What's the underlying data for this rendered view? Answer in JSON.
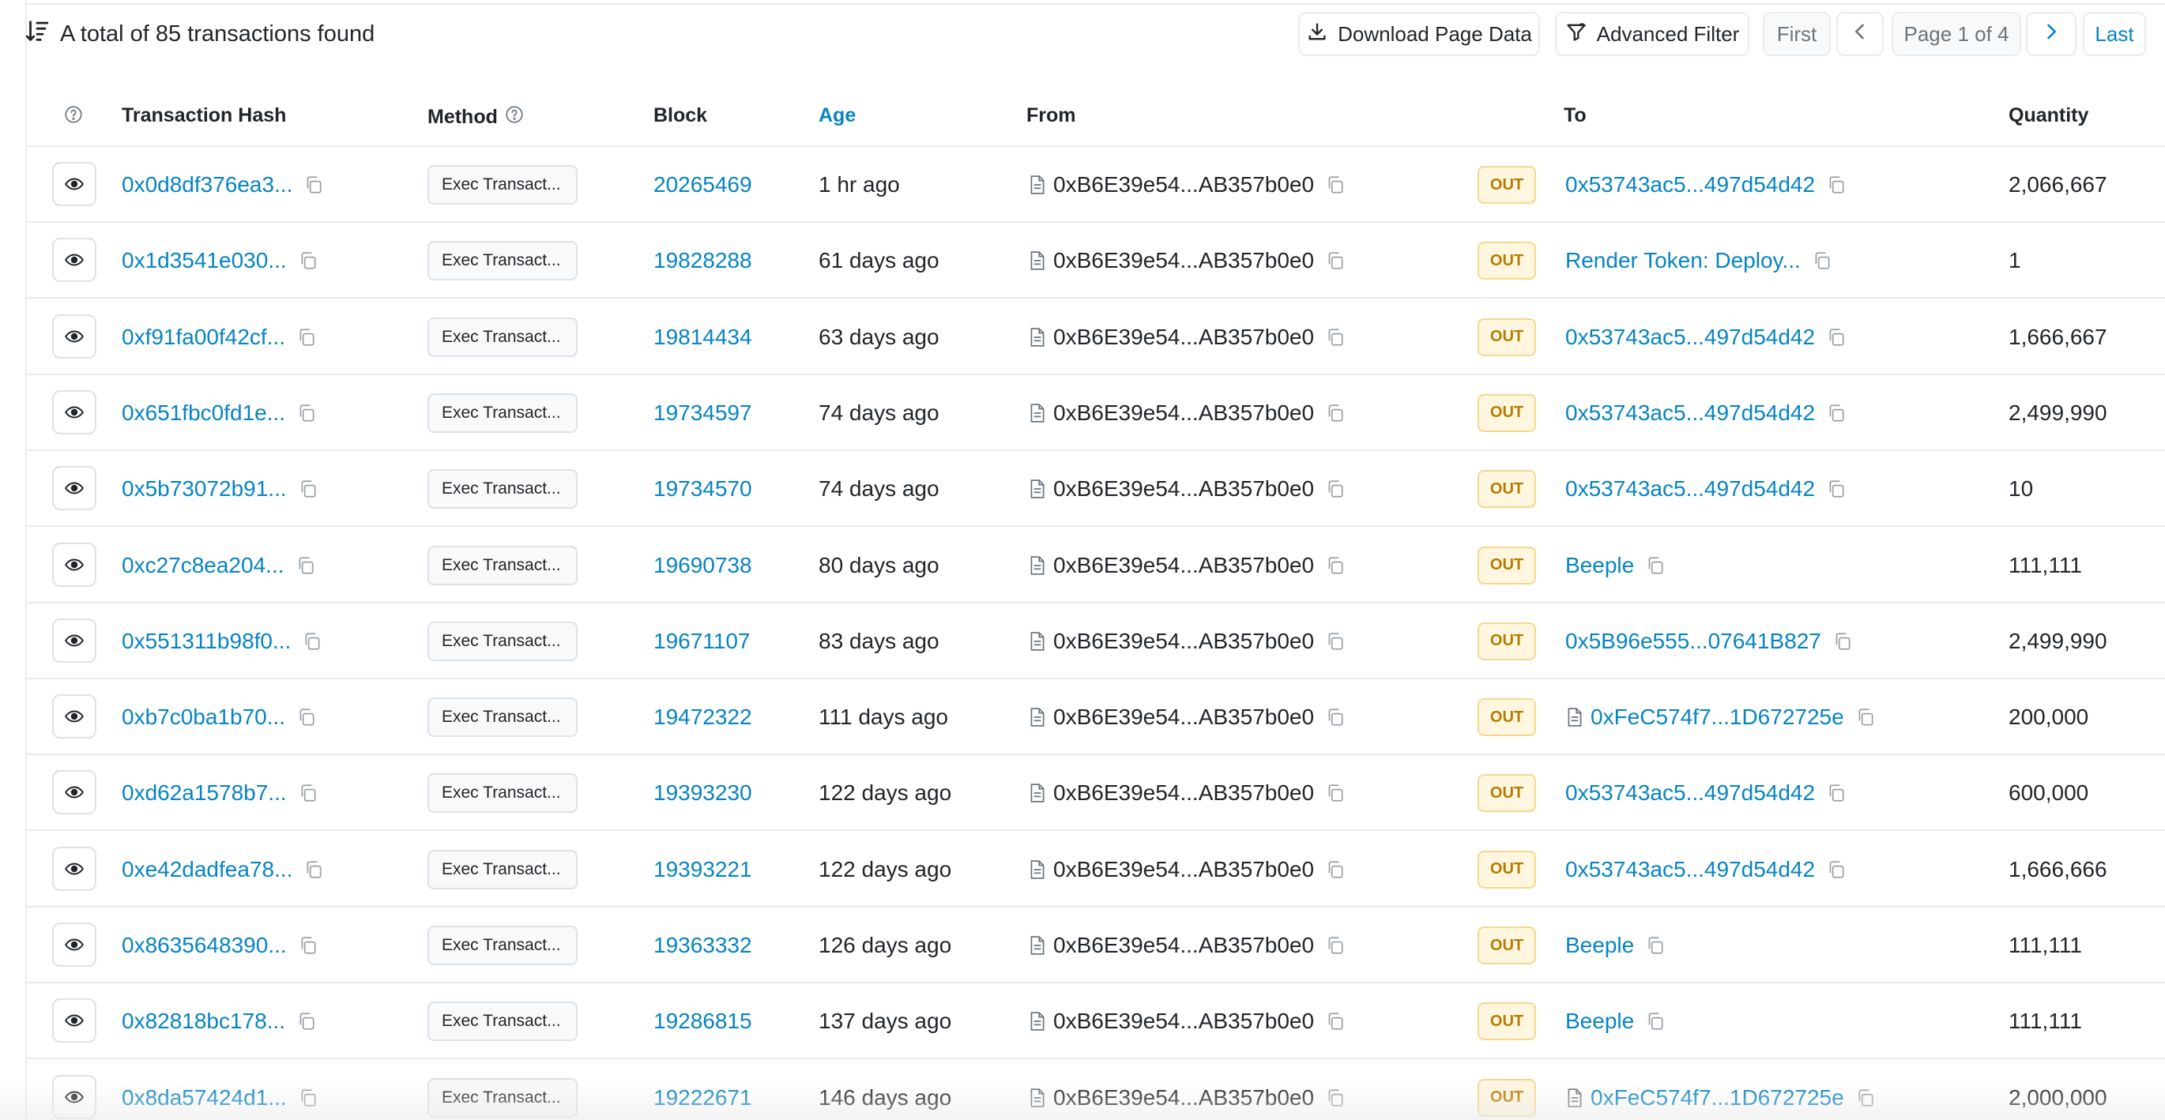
{
  "header": {
    "total_text": "A total of 85 transactions found",
    "download_label": "Download Page Data",
    "filter_label": "Advanced Filter",
    "first_label": "First",
    "page_label": "Page 1 of 4",
    "last_label": "Last"
  },
  "columns": {
    "hash": "Transaction Hash",
    "method": "Method",
    "block": "Block",
    "age": "Age",
    "from": "From",
    "to": "To",
    "quantity": "Quantity"
  },
  "colors": {
    "link": "#0784c3",
    "out_bg": "#fff6e0",
    "out_text": "#b47d00"
  },
  "rows": [
    {
      "hash": "0x0d8df376ea3...",
      "method": "Exec Transact...",
      "block": "20265469",
      "age": "1 hr ago",
      "from": "0xB6E39e54...AB357b0e0",
      "direction": "OUT",
      "to": "0x53743ac5...497d54d42",
      "to_contract": false,
      "quantity": "2,066,667"
    },
    {
      "hash": "0x1d3541e030...",
      "method": "Exec Transact...",
      "block": "19828288",
      "age": "61 days ago",
      "from": "0xB6E39e54...AB357b0e0",
      "direction": "OUT",
      "to": "Render Token: Deploy...",
      "to_contract": false,
      "quantity": "1"
    },
    {
      "hash": "0xf91fa00f42cf...",
      "method": "Exec Transact...",
      "block": "19814434",
      "age": "63 days ago",
      "from": "0xB6E39e54...AB357b0e0",
      "direction": "OUT",
      "to": "0x53743ac5...497d54d42",
      "to_contract": false,
      "quantity": "1,666,667"
    },
    {
      "hash": "0x651fbc0fd1e...",
      "method": "Exec Transact...",
      "block": "19734597",
      "age": "74 days ago",
      "from": "0xB6E39e54...AB357b0e0",
      "direction": "OUT",
      "to": "0x53743ac5...497d54d42",
      "to_contract": false,
      "quantity": "2,499,990"
    },
    {
      "hash": "0x5b73072b91...",
      "method": "Exec Transact...",
      "block": "19734570",
      "age": "74 days ago",
      "from": "0xB6E39e54...AB357b0e0",
      "direction": "OUT",
      "to": "0x53743ac5...497d54d42",
      "to_contract": false,
      "quantity": "10"
    },
    {
      "hash": "0xc27c8ea204...",
      "method": "Exec Transact...",
      "block": "19690738",
      "age": "80 days ago",
      "from": "0xB6E39e54...AB357b0e0",
      "direction": "OUT",
      "to": "Beeple",
      "to_contract": false,
      "quantity": "111,111"
    },
    {
      "hash": "0x551311b98f0...",
      "method": "Exec Transact...",
      "block": "19671107",
      "age": "83 days ago",
      "from": "0xB6E39e54...AB357b0e0",
      "direction": "OUT",
      "to": "0x5B96e555...07641B827",
      "to_contract": false,
      "quantity": "2,499,990"
    },
    {
      "hash": "0xb7c0ba1b70...",
      "method": "Exec Transact...",
      "block": "19472322",
      "age": "111 days ago",
      "from": "0xB6E39e54...AB357b0e0",
      "direction": "OUT",
      "to": "0xFeC574f7...1D672725e",
      "to_contract": true,
      "quantity": "200,000"
    },
    {
      "hash": "0xd62a1578b7...",
      "method": "Exec Transact...",
      "block": "19393230",
      "age": "122 days ago",
      "from": "0xB6E39e54...AB357b0e0",
      "direction": "OUT",
      "to": "0x53743ac5...497d54d42",
      "to_contract": false,
      "quantity": "600,000"
    },
    {
      "hash": "0xe42dadfea78...",
      "method": "Exec Transact...",
      "block": "19393221",
      "age": "122 days ago",
      "from": "0xB6E39e54...AB357b0e0",
      "direction": "OUT",
      "to": "0x53743ac5...497d54d42",
      "to_contract": false,
      "quantity": "1,666,666"
    },
    {
      "hash": "0x8635648390...",
      "method": "Exec Transact...",
      "block": "19363332",
      "age": "126 days ago",
      "from": "0xB6E39e54...AB357b0e0",
      "direction": "OUT",
      "to": "Beeple",
      "to_contract": false,
      "quantity": "111,111"
    },
    {
      "hash": "0x82818bc178...",
      "method": "Exec Transact...",
      "block": "19286815",
      "age": "137 days ago",
      "from": "0xB6E39e54...AB357b0e0",
      "direction": "OUT",
      "to": "Beeple",
      "to_contract": false,
      "quantity": "111,111"
    },
    {
      "hash": "0x8da57424d1...",
      "method": "Exec Transact...",
      "block": "19222671",
      "age": "146 days ago",
      "from": "0xB6E39e54...AB357b0e0",
      "direction": "OUT",
      "to": "0xFeC574f7...1D672725e",
      "to_contract": true,
      "quantity": "2,000,000"
    }
  ]
}
